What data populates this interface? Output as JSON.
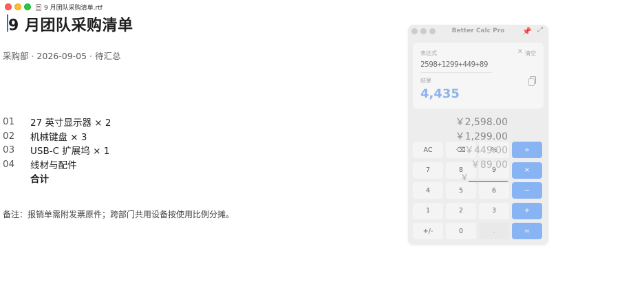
{
  "window": {
    "doc_filename": "9 月团队采购清单.rtf"
  },
  "document": {
    "heading": "9 月团队采购清单",
    "meta": "采购部 · 2026-09-05 · 待汇总",
    "items": [
      {
        "num": "01",
        "desc": "27 英寸显示器 × 2"
      },
      {
        "num": "02",
        "desc": "机械键盘 × 3"
      },
      {
        "num": "03",
        "desc": "USB-C 扩展坞 × 1"
      },
      {
        "num": "04",
        "desc": "线材与配件"
      },
      {
        "num": "",
        "desc": "合计"
      }
    ],
    "note": "备注：报销单需附发票原件；跨部门共用设备按使用比例分摊。"
  },
  "amounts": {
    "lines": [
      "￥2,598.00",
      "￥1,299.00",
      "￥449.00",
      "￥89.00"
    ],
    "total_prefix": "￥"
  },
  "calculator": {
    "title": "Better Calc Pro",
    "icons": {
      "pin": "pin-icon",
      "expand": "expand-icon",
      "copy": "copy-icon"
    },
    "expression_label": "表达式",
    "clear_label": "清空",
    "clear_icon": "✕",
    "expression": "2598+1299+449+89",
    "result_label": "结果",
    "result": "4,435",
    "keys": [
      {
        "label": "AC",
        "type": "fn"
      },
      {
        "label": "⌫",
        "type": "fn"
      },
      {
        "label": "%",
        "type": "fn"
      },
      {
        "label": "÷",
        "type": "op"
      },
      {
        "label": "7",
        "type": "num"
      },
      {
        "label": "8",
        "type": "num"
      },
      {
        "label": "9",
        "type": "num"
      },
      {
        "label": "×",
        "type": "op"
      },
      {
        "label": "4",
        "type": "num"
      },
      {
        "label": "5",
        "type": "num"
      },
      {
        "label": "6",
        "type": "num"
      },
      {
        "label": "−",
        "type": "op"
      },
      {
        "label": "1",
        "type": "num"
      },
      {
        "label": "2",
        "type": "num"
      },
      {
        "label": "3",
        "type": "num"
      },
      {
        "label": "+",
        "type": "op"
      },
      {
        "label": "+/-",
        "type": "fn"
      },
      {
        "label": "0",
        "type": "num"
      },
      {
        "label": ".",
        "type": "dim"
      },
      {
        "label": "=",
        "type": "op"
      }
    ],
    "accent_color": "#80aef3",
    "result_color": "#86aee9"
  }
}
